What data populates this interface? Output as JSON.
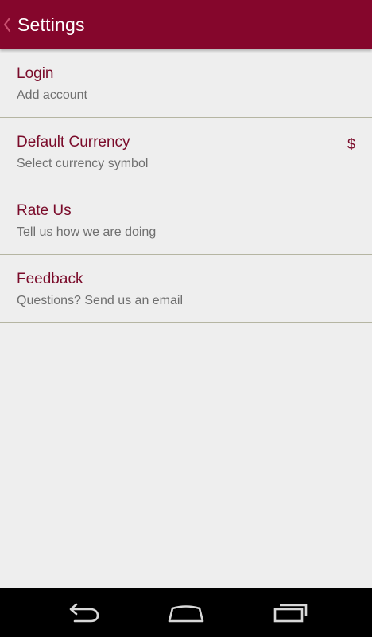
{
  "header": {
    "title": "Settings",
    "back_icon": "chevron-left-icon",
    "background_color": "#85062c"
  },
  "settings": {
    "items": [
      {
        "title": "Login",
        "subtitle": "Add account",
        "value": ""
      },
      {
        "title": "Default Currency",
        "subtitle": "Select currency symbol",
        "value": "$"
      },
      {
        "title": "Rate Us",
        "subtitle": "Tell us how we are doing",
        "value": ""
      },
      {
        "title": "Feedback",
        "subtitle": "Questions? Send us an email",
        "value": ""
      }
    ]
  },
  "nav": {
    "back_icon": "back-arrow-icon",
    "home_icon": "home-icon",
    "recents_icon": "recent-apps-icon"
  },
  "colors": {
    "accent": "#7a0b2a",
    "subtitle": "#6f6f6f",
    "background": "#eeeeee",
    "divider": "#b5b5a2"
  }
}
